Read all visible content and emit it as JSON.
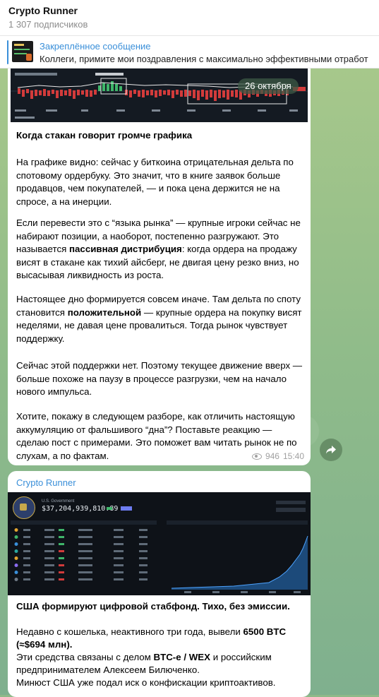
{
  "channel": {
    "title": "Crypto Runner",
    "subscribers": "1 307 подписчиков"
  },
  "pinned": {
    "title": "Закреплённое сообщение",
    "text": "Коллеги, примите мои поздравления с максимально эффективными отработ"
  },
  "post1": {
    "date_pill": "26 октября",
    "heading": "Когда стакан говорит громче графика",
    "p1": "На графике видно: сейчас у биткоина отрицательная дельта по спотовому ордербуку. Это значит, что в книге заявок больше продавцов, чем покупателей, — и пока цена держится не на спросе, а на инерции.",
    "p2a": "Если перевести это с “языка рынка” — крупные игроки сейчас не набирают позиции, а наоборот, постепенно разгружают. Это называется ",
    "p2b": "пассивная дистрибуция",
    "p2c": ": когда ордера на продажу висят в стакане как тихий айсберг, не двигая цену резко вниз, но высасывая ликвидность из роста.",
    "p3a": "Настоящее дно формируется совсем иначе. Там дельта по споту становится ",
    "p3b": "положительной",
    "p3c": " — крупные ордера на покупку висят неделями, не давая цене провалиться. Тогда рынок чувствует поддержку.",
    "p4": "Сейчас этой поддержки нет. Поэтому текущее движение вверх — больше похоже на паузу в процессе разгрузки, чем на начало нового импульса.",
    "p5": "Хотите, покажу в следующем разборе, как отличить настоящую аккумуляцию от фальшивого “дна”? Поставьте реакцию — сделаю пост с примерами. Это поможет вам читать рынок не по слухам, а по фактам.",
    "views": "946",
    "time": "15:40"
  },
  "post2": {
    "forwarded_from": "Crypto Runner",
    "image": {
      "entity": "U.S. Government",
      "balance": "$37,204,939,810.89"
    },
    "heading": "США формируют цифровой стабфонд. Тихо, без эмиссии.",
    "l1a": "Недавно с кошелька, неактивного три года, вывели ",
    "l1b": "6500 BTC",
    "l2": "(≈$694 млн).",
    "l3a": "Эти средства связаны с делом ",
    "l3b": "BTC-e / WEX",
    "l3c": " и российским",
    "l4": "предпринимателем Алексеем Билюченко.",
    "l5": "Минюст США уже подал иск о конфискации криптоактивов."
  },
  "colors": {
    "accent": "#3a8fd9",
    "background": "#8fb989",
    "bubble": "#ffffff"
  }
}
